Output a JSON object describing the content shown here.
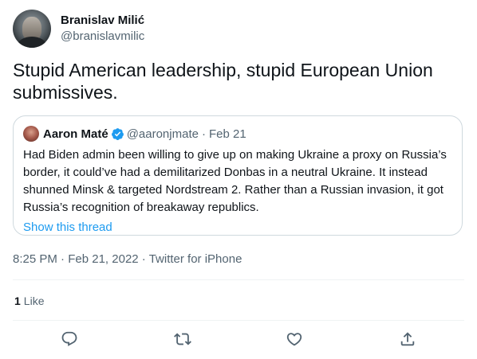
{
  "author": {
    "display_name": "Branislav Milić",
    "handle": "@branislavmilic"
  },
  "tweet": {
    "text": "Stupid American leadership, stupid European Union submissives."
  },
  "quoted": {
    "display_name": "Aaron Maté",
    "handle": "@aaronjmate",
    "separator": "·",
    "date": "Feb 21",
    "text": "Had Biden admin been willing to give up on making Ukraine a proxy on Russia’s border, it could’ve had a demilitarized Donbas in a neutral Ukraine. It instead shunned Minsk & targeted Nordstream 2. Rather than a Russian invasion, it got Russia’s recognition of breakaway republics.",
    "show_thread": "Show this thread",
    "verified_color": "#1d9bf0"
  },
  "meta": {
    "time": "8:25 PM",
    "separator1": "·",
    "date": "Feb 21, 2022",
    "separator2": "·",
    "source": "Twitter for iPhone"
  },
  "stats": {
    "likes_count": "1",
    "likes_label": "Like"
  },
  "actions": [
    "reply-icon",
    "retweet-icon",
    "like-icon",
    "share-icon"
  ],
  "colors": {
    "accent": "#1d9bf0",
    "secondary_text": "#536471",
    "primary_text": "#0f1419",
    "border": "#cfd9de"
  }
}
